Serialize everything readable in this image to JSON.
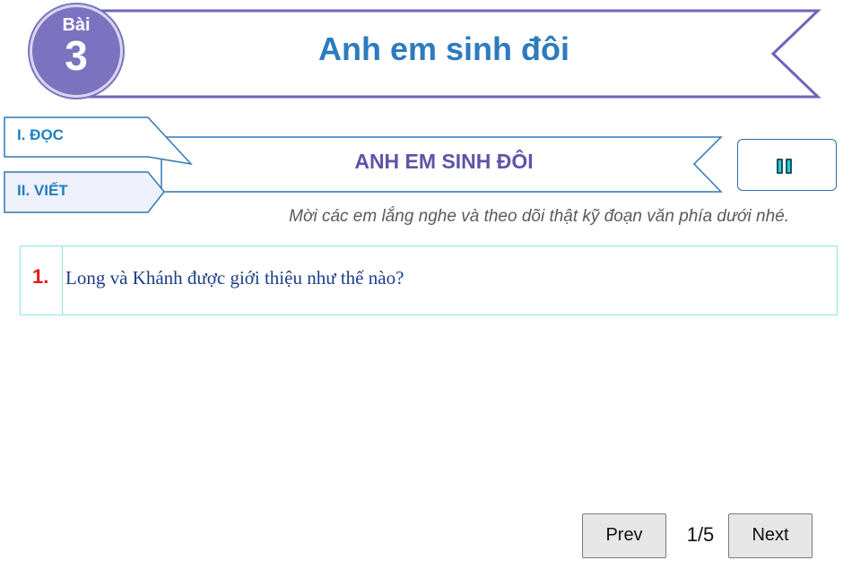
{
  "lesson": {
    "badge_word": "Bài",
    "badge_number": "3",
    "title": "Anh em sinh đôi"
  },
  "tabs": [
    {
      "label": "I. ĐỌC"
    },
    {
      "label": "II. VIẾT"
    }
  ],
  "section": {
    "heading": "ANH EM SINH ĐÔI",
    "instruction": "Mời các em lắng nghe và theo dõi thật kỹ đoạn văn phía dưới nhé."
  },
  "audio_control": {
    "icon": "pause-icon",
    "state": "playing"
  },
  "question": {
    "number": "1.",
    "text": "Long và Khánh được giới thiệu như thế nào?"
  },
  "pagination": {
    "prev_label": "Prev",
    "next_label": "Next",
    "indicator": "1/5"
  },
  "colors": {
    "accent_purple": "#7b73bf",
    "title_blue": "#2d7bbf",
    "heading_purple": "#5c55a8",
    "question_number_red": "#e11b1b",
    "question_border_cyan": "#8ee4ec"
  }
}
